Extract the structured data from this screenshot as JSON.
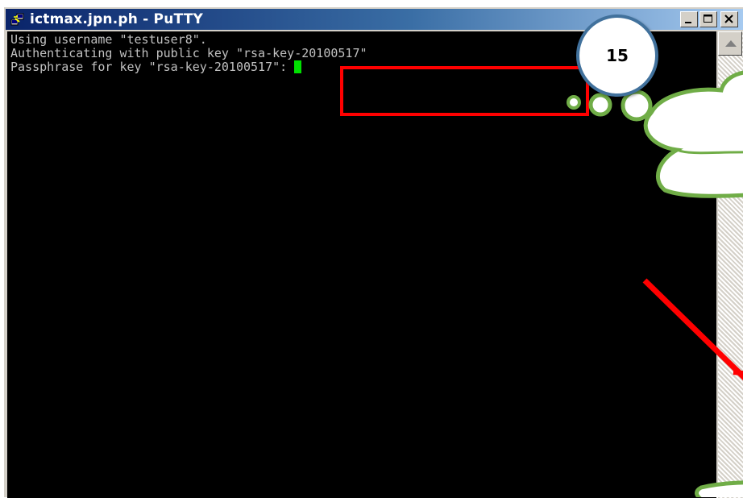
{
  "window": {
    "title": "ictmax.jpn.ph - PuTTY",
    "icon": "putty-icon"
  },
  "controls": {
    "minimize_icon": "minimize-icon",
    "maximize_icon": "maximize-icon",
    "close_icon": "close-icon"
  },
  "terminal": {
    "lines": [
      "Using username \"testuser8\".",
      "Authenticating with public key \"rsa-key-20100517\"",
      "Passphrase for key \"rsa-key-20100517\": "
    ],
    "cursor_color": "#00e000"
  },
  "annotation": {
    "step_number": "15",
    "highlight_color": "#ff0000",
    "callout_border_color": "#70ad47",
    "badge_border_color": "#41719c"
  }
}
